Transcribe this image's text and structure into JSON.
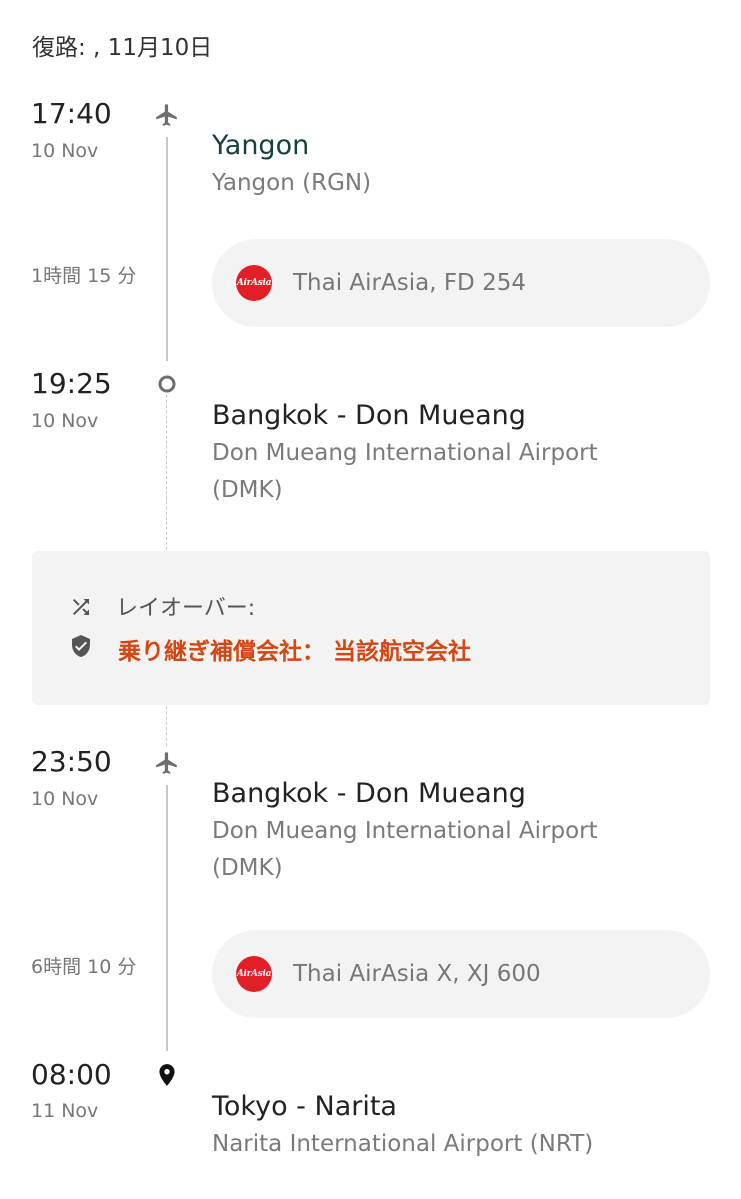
{
  "header": {
    "title": "復路: , 11月10日"
  },
  "segments": [
    {
      "dep_time": "17:40",
      "dep_date": "10 Nov",
      "dep_city": "Yangon",
      "dep_airport": "Yangon (RGN)",
      "duration": "1時間 15 分",
      "flight": "Thai AirAsia, FD 254",
      "arr_time": "19:25",
      "arr_date": "10 Nov",
      "arr_city": "Bangkok - Don Mueang",
      "arr_airport": "Don Mueang International Airport (DMK)"
    },
    {
      "dep_time": "23:50",
      "dep_date": "10 Nov",
      "dep_city": "Bangkok - Don Mueang",
      "dep_airport": "Don Mueang International Airport (DMK)",
      "duration": "6時間 10 分",
      "flight": "Thai AirAsia X, XJ 600",
      "arr_time": "08:00",
      "arr_date": "11 Nov",
      "arr_city": "Tokyo - Narita",
      "arr_airport": "Narita International Airport (NRT)"
    }
  ],
  "layover": {
    "label": "レイオーバー:",
    "protection": "乗り継ぎ補償会社： 当該航空会社"
  },
  "airline_logo_text": "AirAsia",
  "colors": {
    "accent": "#d44612",
    "airasia_red": "#e21f26",
    "pill_bg": "#f3f3f3"
  },
  "icons": [
    "plane-icon",
    "circle-stop-icon",
    "shuffle-icon",
    "shield-icon",
    "location-pin-icon"
  ]
}
